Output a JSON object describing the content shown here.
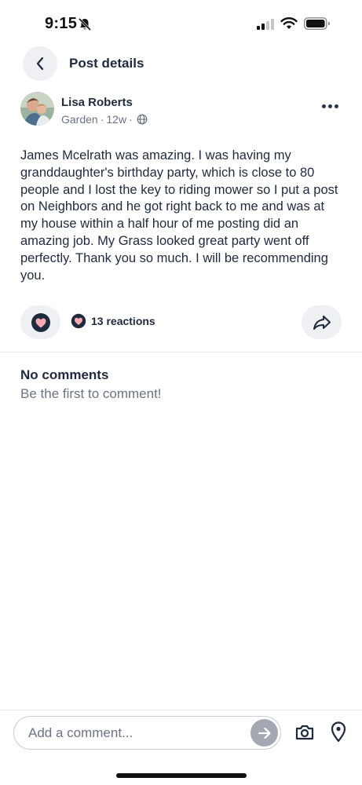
{
  "status_bar": {
    "time": "9:15"
  },
  "header": {
    "title": "Post details"
  },
  "post": {
    "author": "Lisa Roberts",
    "category": "Garden",
    "separator": "·",
    "age": "12w",
    "body": "James Mcelrath was amazing. I was having my granddaughter's birthday party, which is close to 80 people and I lost the key to riding mower so I put a post on Neighbors and he got right back to me and was at my house within a half hour of me posting did an amazing job. My Grass looked great party went off perfectly. Thank you so much. I will be recommending you.",
    "reactions_label": "13 reactions"
  },
  "comments": {
    "empty_title": "No comments",
    "empty_subtitle": "Be the first to comment!"
  },
  "composer": {
    "placeholder": "Add a comment..."
  },
  "colors": {
    "text": "#1f2a3c",
    "muted": "#6b7385",
    "heart": "#f4a9b3",
    "pill_bg": "#eef0f3"
  },
  "icons": [
    "bell-off-icon",
    "signal-icon",
    "wifi-icon",
    "battery-icon",
    "chevron-left-icon",
    "globe-icon",
    "more-icon",
    "heart-icon",
    "share-icon",
    "arrow-right-icon",
    "camera-icon",
    "location-pin-icon"
  ]
}
